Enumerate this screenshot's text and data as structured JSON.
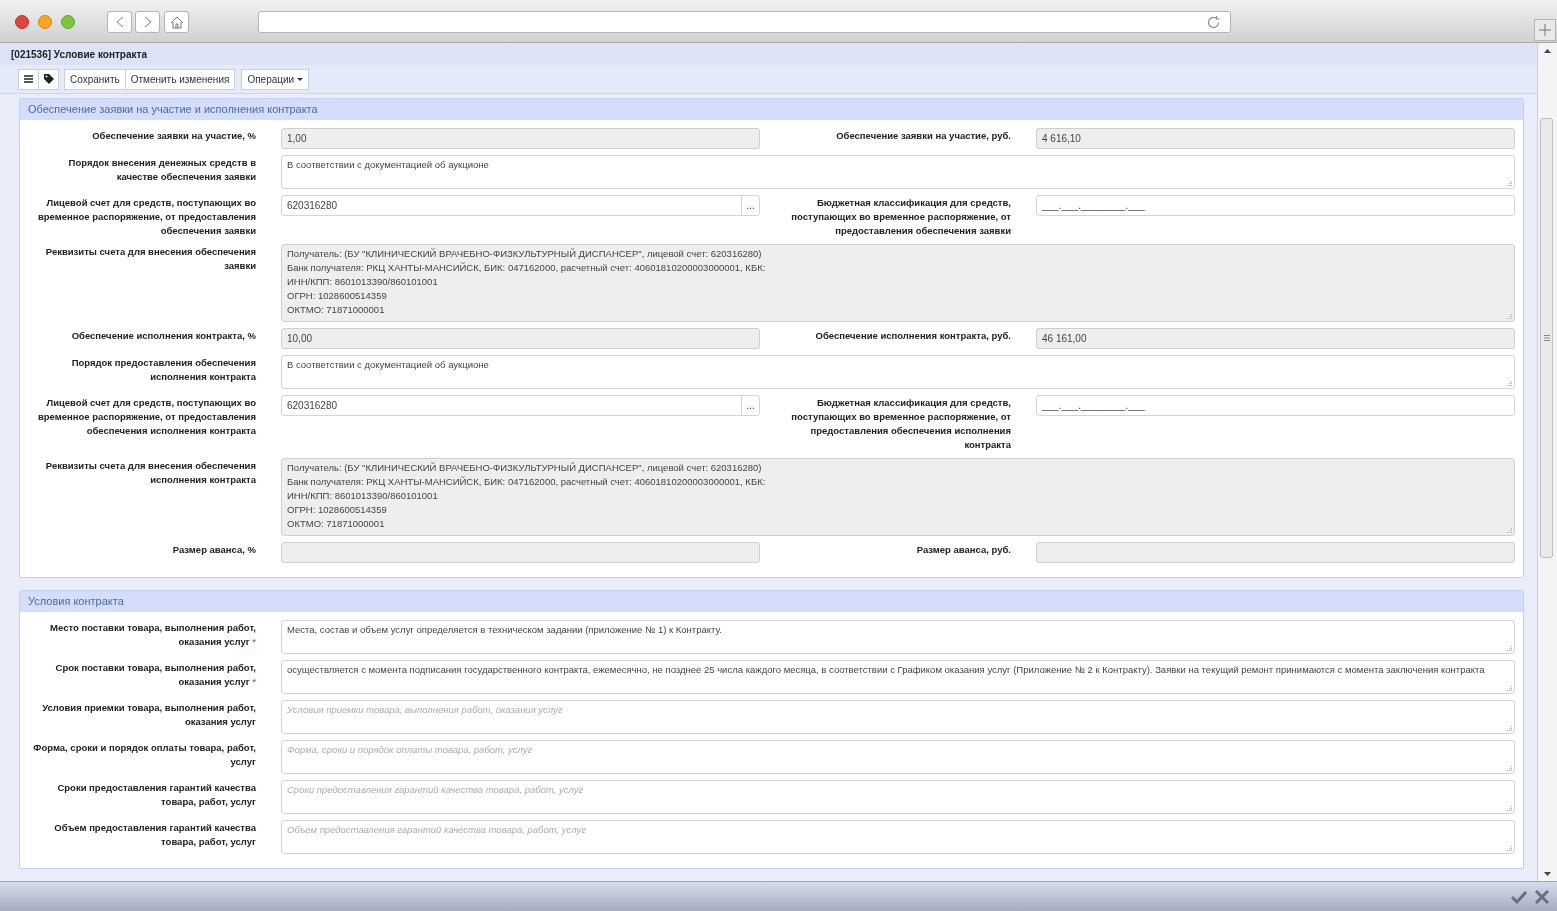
{
  "window": {
    "title": "[021536] Условие контракта"
  },
  "toolbar": {
    "buttons": [
      {
        "kind": "menu"
      },
      {
        "kind": "tag"
      },
      {
        "kind": "text",
        "label": "Сохранить"
      },
      {
        "kind": "text",
        "label": "Отменить изменения"
      }
    ],
    "dropdown": {
      "label": "Операции"
    }
  },
  "sections": [
    {
      "title": "Обеспечение заявки на участие и исполнения контракта",
      "rows": [
        {
          "kind": "pair",
          "fields": [
            {
              "kind": "input",
              "label": "Обеспечение заявки на участие, %",
              "value": "1,00",
              "readonly": true
            },
            {
              "kind": "input",
              "label": "Обеспечение заявки на участие, руб.",
              "value": "4 616,10",
              "readonly": true
            }
          ]
        },
        {
          "kind": "wide",
          "field": {
            "label": "Порядок внесения денежных средств в качестве обеспечения заявки",
            "lines": [
              "В соответствии с документацией об аукционе"
            ],
            "readonly": false
          }
        },
        {
          "kind": "pair",
          "fields": [
            {
              "kind": "lookup",
              "label": "Лицевой счет для средств, поступающих во временное распоряжение, от предоставления обеспечения заявки",
              "value": "620316280",
              "button": "...",
              "readonly": false
            },
            {
              "kind": "input",
              "label": "Бюджетная классификация для средств, поступающих во временное распоряжение, от предоставления обеспечения заявки",
              "value": "___.___.________.___",
              "readonly": false
            }
          ]
        },
        {
          "kind": "wide",
          "field": {
            "label": "Реквизиты счета для внесения обеспечения заявки",
            "lines": [
              "Получатель:  (БУ \"КЛИНИЧЕСКИЙ ВРАЧЕБНО-ФИЗКУЛЬТУРНЫЙ ДИСПАНСЕР\", лицевой счет: 620316280)",
              "Банк получателя: РКЦ ХАНТЫ-МАНСИЙСК, БИК: 047162000, расчетный счет: 40601810200003000001, КБК:",
              "ИНН/КПП: 8601013390/860101001",
              "ОГРН: 1028600514359",
              "ОКТМО: 71871000001"
            ],
            "readonly": true
          }
        },
        {
          "kind": "pair",
          "fields": [
            {
              "kind": "input",
              "label": "Обеспечение исполнения контракта, %",
              "value": "10,00",
              "readonly": true
            },
            {
              "kind": "input",
              "label": "Обеспечение исполнения контракта, руб.",
              "value": "46 161,00",
              "readonly": true
            }
          ]
        },
        {
          "kind": "wide",
          "field": {
            "label": "Порядок предоставления обеспечения исполнения контракта",
            "lines": [
              "В соответствии с документацией об аукционе"
            ],
            "readonly": false
          }
        },
        {
          "kind": "pair",
          "fields": [
            {
              "kind": "lookup",
              "label": "Лицевой счет для средств, поступающих во временное распоряжение, от предоставления обеспечения исполнения контракта",
              "value": "620316280",
              "button": "...",
              "readonly": false
            },
            {
              "kind": "input",
              "label": "Бюджетная классификация для средств, поступающих во временное распоряжение, от предоставления обеспечения исполнения контракта",
              "value": "___.___.________.___",
              "readonly": false
            }
          ]
        },
        {
          "kind": "wide",
          "field": {
            "label": "Реквизиты счета для внесения обеспечения исполнения контракта",
            "lines": [
              "Получатель:  (БУ \"КЛИНИЧЕСКИЙ ВРАЧЕБНО-ФИЗКУЛЬТУРНЫЙ ДИСПАНСЕР\", лицевой счет: 620316280)",
              "Банк получателя: РКЦ ХАНТЫ-МАНСИЙСК, БИК: 047162000, расчетный счет: 40601810200003000001, КБК:",
              "ИНН/КПП: 8601013390/860101001",
              "ОГРН: 1028600514359",
              "ОКТМО: 71871000001"
            ],
            "readonly": true
          }
        },
        {
          "kind": "pair",
          "fields": [
            {
              "kind": "input",
              "label": "Размер аванса, %",
              "readonly": true
            },
            {
              "kind": "input",
              "label": "Размер аванса, руб.",
              "readonly": true
            }
          ]
        }
      ]
    },
    {
      "title": "Условия контракта",
      "rows": [
        {
          "kind": "wide",
          "field": {
            "label": "Место поставки товара, выполнения работ, оказания услуг",
            "required_mark": "*",
            "lines": [
              "Места, состав и объем услуг определяется в техническом задании (приложение № 1) к Контракту."
            ],
            "readonly": false
          }
        },
        {
          "kind": "wide",
          "field": {
            "label": "Срок поставки товара, выполнения работ, оказания услуг",
            "required_mark": "*",
            "lines": [
              "осуществляется с момента подписания государственного контракта, ежемесячно, не позднее 25 числа каждого месяца, в соответствии с Графиком оказания услуг (Приложение № 2 к Контракту). Заявки на текущий ремонт принимаются с момента заключения контракта"
            ],
            "readonly": false
          }
        },
        {
          "kind": "wide",
          "field": {
            "label": "Условия приемки товара, выполнения работ, оказания услуг",
            "placeholder": "Условия приемки товара, выполнения работ, оказания услуг",
            "readonly": false
          }
        },
        {
          "kind": "wide",
          "field": {
            "label": "Форма, сроки и порядок оплаты товара, работ, услуг",
            "placeholder": "Форма, сроки и порядок оплаты товара, работ, услуг",
            "readonly": false
          }
        },
        {
          "kind": "wide",
          "field": {
            "label": "Сроки предоставления гарантий качества товара, работ, услуг",
            "placeholder": "Сроки предоставления гарантий качества товара, работ, услуг",
            "readonly": false
          }
        },
        {
          "kind": "wide",
          "field": {
            "label": "Объем предоставления гарантий качества товара, работ, услуг",
            "placeholder": "Объем предоставления гарантий качества товара, работ, услуг",
            "readonly": false
          }
        }
      ]
    }
  ]
}
